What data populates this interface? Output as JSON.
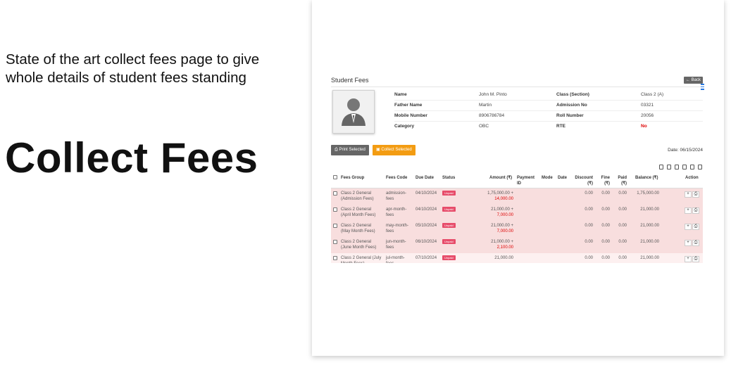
{
  "slide": {
    "subtitle": "State of the art collect fees page to give whole details of student fees standing",
    "title": "Collect Fees"
  },
  "page": {
    "title": "Student Fees",
    "back_label": "Back",
    "print_selected": "Print Selected",
    "collect_selected": "Collect Selected",
    "date": "Date: 06/15/2024"
  },
  "student": {
    "name_label": "Name",
    "name": "John M. Pinto",
    "father_label": "Father Name",
    "father": "Martin",
    "mobile_label": "Mobile Number",
    "mobile": "8906786784",
    "category_label": "Category",
    "category": "OBC",
    "class_label": "Class (Section)",
    "class": "Class 2 (A)",
    "admission_label": "Admission No",
    "admission": "03321",
    "roll_label": "Roll Number",
    "roll": "20056",
    "rte_label": "RTE",
    "rte": "No"
  },
  "table": {
    "headers": {
      "fees_group": "Fees Group",
      "fees_code": "Fees Code",
      "due_date": "Due Date",
      "status": "Status",
      "amount": "Amount (₹)",
      "payment_id": "Payment\nID",
      "mode": "Mode",
      "date": "Date",
      "discount": "Discount\n(₹)",
      "fine": "Fine\n(₹)",
      "paid": "Paid\n(₹)",
      "balance": "Balance (₹)",
      "action": "Action"
    },
    "rows": [
      {
        "group": "Class 2 General\n(Admission Fees)",
        "code": "admission-\nfees",
        "due": "04/10/2024",
        "status": "Unpaid",
        "amount": "1,75,000.00 +",
        "fine_amount": "14,000.00",
        "discount": "0.00",
        "fine": "0.00",
        "paid": "0.00",
        "balance": "1,75,000.00"
      },
      {
        "group": "Class 2 General\n(April Month Fees)",
        "code": "apr-month-\nfees",
        "due": "04/10/2024",
        "status": "Unpaid",
        "amount": "21,000.00 +",
        "fine_amount": "7,000.00",
        "discount": "0.00",
        "fine": "0.00",
        "paid": "0.00",
        "balance": "21,000.00"
      },
      {
        "group": "Class 2 General\n(May Month Fees)",
        "code": "may-month-\nfees",
        "due": "05/10/2024",
        "status": "Unpaid",
        "amount": "21,000.00 +",
        "fine_amount": "7,000.00",
        "discount": "0.00",
        "fine": "0.00",
        "paid": "0.00",
        "balance": "21,000.00"
      },
      {
        "group": "Class 2 General\n(June Month Fees)",
        "code": "jun-month-\nfees",
        "due": "06/10/2024",
        "status": "Unpaid",
        "amount": "21,000.00 +",
        "fine_amount": "2,100.00",
        "discount": "0.00",
        "fine": "0.00",
        "paid": "0.00",
        "balance": "21,000.00"
      },
      {
        "group": "Class 2 General (July\nMonth Fees)",
        "code": "jul-month-\nfees",
        "due": "07/10/2024",
        "status": "Unpaid",
        "amount": "21,000.00",
        "fine_amount": "",
        "discount": "0.00",
        "fine": "0.00",
        "paid": "0.00",
        "balance": "21,000.00"
      }
    ]
  },
  "colors": {
    "collect_button": "#f39c12",
    "print_button": "#666666",
    "unpaid_badge": "#e74c6a",
    "unpaid_row": "#f8dede",
    "fine_text": "#dd0000"
  }
}
